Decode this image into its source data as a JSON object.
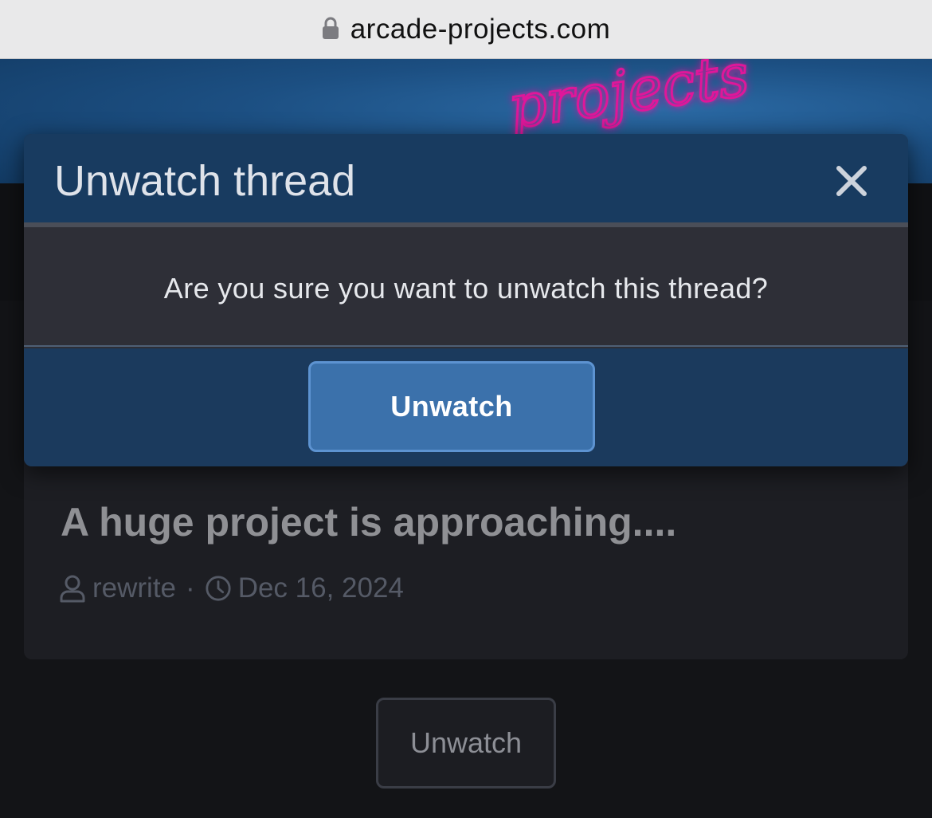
{
  "browser": {
    "url": "arcade-projects.com",
    "icons": {
      "lock": "lock-icon"
    }
  },
  "header": {
    "logo_text": "projects",
    "colors": {
      "banner": "#1c4f82",
      "neon": "#e0179a"
    }
  },
  "modal": {
    "title": "Unwatch thread",
    "close_icon": "close-icon",
    "message": "Are you sure you want to unwatch this thread?",
    "confirm_label": "Unwatch",
    "colors": {
      "header": "#183b60",
      "body": "#2e2f37",
      "button": "#3b71ab"
    }
  },
  "thread": {
    "title": "A huge project is approaching....",
    "author": "rewrite",
    "separator": "·",
    "date": "Dec 16, 2024",
    "icons": {
      "author": "user-icon",
      "date": "clock-icon"
    }
  },
  "page_actions": {
    "unwatch_label": "Unwatch"
  }
}
